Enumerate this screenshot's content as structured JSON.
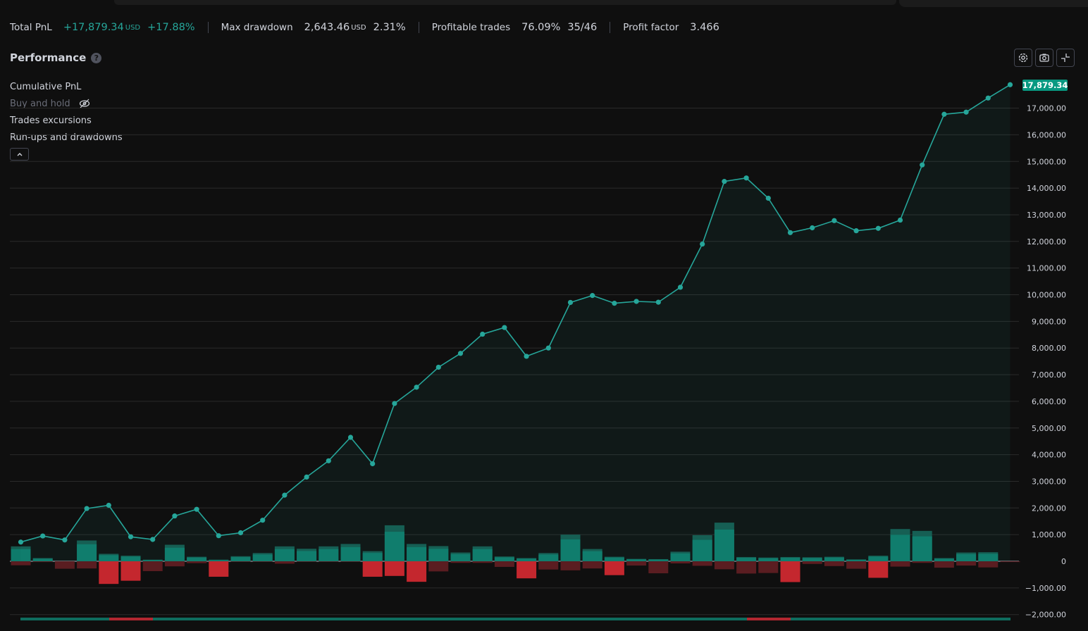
{
  "stats": {
    "total_pnl_label": "Total PnL",
    "total_pnl_value": "+17,879.34",
    "total_pnl_unit": "USD",
    "total_pnl_pct": "+17.88%",
    "max_drawdown_label": "Max drawdown",
    "max_drawdown_value": "2,643.46",
    "max_drawdown_unit": "USD",
    "max_drawdown_pct": "2.31%",
    "profitable_label": "Profitable trades",
    "profitable_pct": "76.09%",
    "profitable_ratio": "35/46",
    "profit_factor_label": "Profit factor",
    "profit_factor_value": "3.466"
  },
  "section": {
    "title": "Performance",
    "help": "?"
  },
  "legend": {
    "cumulative": "Cumulative PnL",
    "buy_hold": "Buy and hold",
    "excursions": "Trades excursions",
    "runups": "Run-ups and drawdowns"
  },
  "toolbar": {
    "icons": [
      "settings-icon",
      "camera-icon",
      "collapse-icon"
    ]
  },
  "colors": {
    "line": "#26a69a",
    "fill": "rgba(38,166,154,0.07)",
    "bar_pos": "#0e7a6a",
    "bar_pos_ext": "#155a4f",
    "bar_neg": "#c4272e",
    "bar_neg_ext": "#5a1d21",
    "grid": "#2a2a2a",
    "axis_text": "#d1d4dc",
    "badge": "#089981"
  },
  "chart_data": {
    "type": "line",
    "title": "",
    "last_value_label": "17,879.34",
    "ylim": [
      -2000,
      17900
    ],
    "y_ticks": [
      "17,000.00",
      "16,000.00",
      "15,000.00",
      "14,000.00",
      "13,000.00",
      "12,000.00",
      "11,000.00",
      "10,000.00",
      "9,000.00",
      "8,000.00",
      "7,000.00",
      "6,000.00",
      "5,000.00",
      "4,000.00",
      "3,000.00",
      "2,000.00",
      "1,000.00",
      "0",
      "−1,000.00",
      "−2,000.00"
    ],
    "y_tick_values": [
      17000,
      16000,
      15000,
      14000,
      13000,
      12000,
      11000,
      10000,
      9000,
      8000,
      7000,
      6000,
      5000,
      4000,
      3000,
      2000,
      1000,
      0,
      -1000,
      -2000
    ],
    "trade_index": [
      1,
      2,
      3,
      4,
      5,
      6,
      7,
      8,
      9,
      10,
      11,
      12,
      13,
      14,
      15,
      16,
      17,
      18,
      19,
      20,
      21,
      22,
      23,
      24,
      25,
      26,
      27,
      28,
      29,
      30,
      31,
      32,
      33,
      34,
      35,
      36,
      37,
      38,
      39,
      40,
      41,
      42,
      43,
      44,
      45,
      46
    ],
    "cumulative_pnl": [
      720,
      950,
      800,
      1980,
      2100,
      920,
      820,
      1700,
      1950,
      960,
      1070,
      1540,
      2480,
      3160,
      3770,
      4650,
      3660,
      5920,
      6530,
      7280,
      7800,
      8520,
      8770,
      7690,
      8000,
      9710,
      9970,
      9680,
      9750,
      9720,
      10280,
      11900,
      14250,
      14380,
      13620,
      12330,
      12510,
      12780,
      12400,
      12490,
      12800,
      14870,
      16770,
      16850,
      17380,
      17879
    ],
    "series": [
      {
        "name": "Run-ups",
        "values": [
          560,
          120,
          0,
          780,
          280,
          210,
          60,
          620,
          170,
          60,
          190,
          310,
          560,
          470,
          560,
          650,
          380,
          1350,
          650,
          570,
          330,
          560,
          180,
          120,
          310,
          1000,
          460,
          170,
          90,
          80,
          360,
          980,
          1450,
          160,
          140,
          160,
          150,
          170,
          70,
          210,
          1210,
          1140,
          120,
          330,
          340,
          0
        ]
      },
      {
        "name": "Drawdowns",
        "values": [
          -150,
          -30,
          -280,
          -270,
          -850,
          -730,
          -370,
          -190,
          -70,
          -580,
          -20,
          -20,
          -90,
          -20,
          -20,
          -20,
          -580,
          -550,
          -770,
          -380,
          -60,
          -60,
          -210,
          -640,
          -310,
          -340,
          -270,
          -520,
          -160,
          -450,
          -80,
          -170,
          -300,
          -460,
          -440,
          -780,
          -100,
          -180,
          -280,
          -620,
          -200,
          -60,
          -240,
          -160,
          -230,
          -30
        ]
      }
    ]
  }
}
